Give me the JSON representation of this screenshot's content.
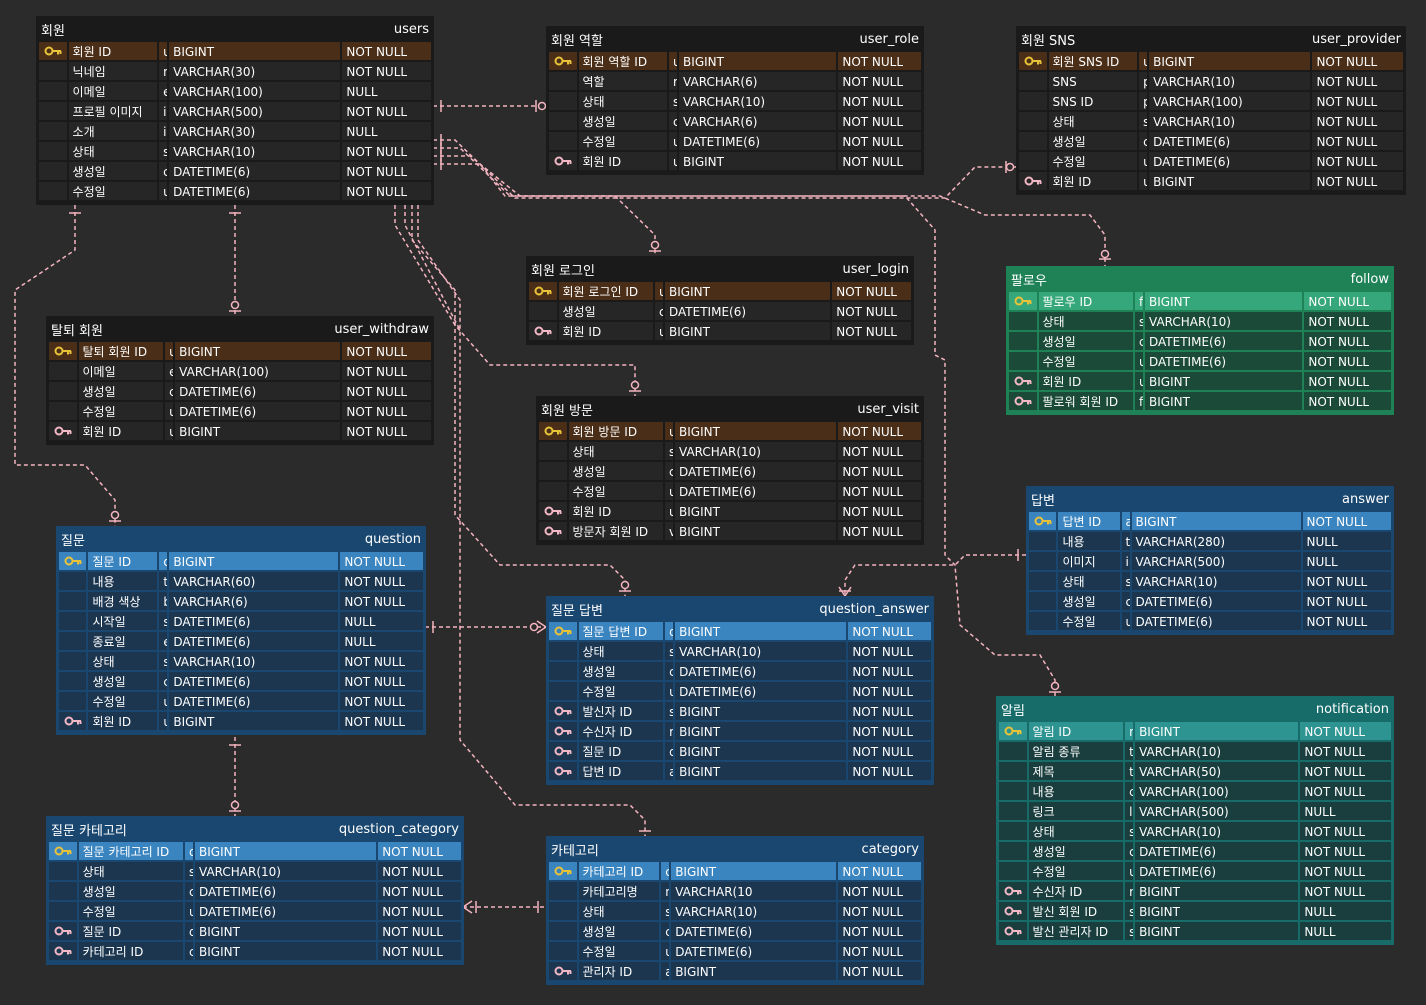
{
  "colors": {
    "line": "#f4b4c0",
    "pk_key": "#e8c33a",
    "fk_key": "#f2b8c6"
  },
  "tables": {
    "users": {
      "label": "회원",
      "name": "users",
      "columns": [
        {
          "kor": "회원 ID",
          "name": "user_id",
          "type": "BIGINT",
          "nullability": "NOT NULL",
          "key": "pk"
        },
        {
          "kor": "닉네임",
          "name": "nickname",
          "type": "VARCHAR(30)",
          "nullability": "NOT NULL",
          "key": ""
        },
        {
          "kor": "이메일",
          "name": "email",
          "type": "VARCHAR(100)",
          "nullability": "NULL",
          "key": ""
        },
        {
          "kor": "프로필 이미지",
          "name": "image_url",
          "type": "VARCHAR(500)",
          "nullability": "NOT NULL",
          "key": ""
        },
        {
          "kor": "소개",
          "name": "introduction",
          "type": "VARCHAR(30)",
          "nullability": "NULL",
          "key": ""
        },
        {
          "kor": "상태",
          "name": "status",
          "type": "VARCHAR(10)",
          "nullability": "NOT NULL",
          "key": ""
        },
        {
          "kor": "생성일",
          "name": "create_date_time",
          "type": "DATETIME(6)",
          "nullability": "NOT NULL",
          "key": ""
        },
        {
          "kor": "수정일",
          "name": "update_date_time",
          "type": "DATETIME(6)",
          "nullability": "NOT NULL",
          "key": ""
        }
      ]
    },
    "user_role": {
      "label": "회원 역할",
      "name": "user_role",
      "columns": [
        {
          "kor": "회원 역할 ID",
          "name": "user_role_id",
          "type": "BIGINT",
          "nullability": "NOT NULL",
          "key": "pk"
        },
        {
          "kor": "역할",
          "name": "role",
          "type": "VARCHAR(6)",
          "nullability": "NOT NULL",
          "key": ""
        },
        {
          "kor": "상태",
          "name": "status",
          "type": "VARCHAR(10)",
          "nullability": "NOT NULL",
          "key": ""
        },
        {
          "kor": "생성일",
          "name": "create_date_time",
          "type": "VARCHAR(6)",
          "nullability": "NOT NULL",
          "key": ""
        },
        {
          "kor": "수정일",
          "name": "update_date_time",
          "type": "DATETIME(6)",
          "nullability": "NOT NULL",
          "key": ""
        },
        {
          "kor": "회원 ID",
          "name": "user_id",
          "type": "BIGINT",
          "nullability": "NOT NULL",
          "key": "fk"
        }
      ]
    },
    "user_provider": {
      "label": "회원 SNS",
      "name": "user_provider",
      "columns": [
        {
          "kor": "회원 SNS ID",
          "name": "user_provider_id",
          "type": "BIGINT",
          "nullability": "NOT NULL",
          "key": "pk"
        },
        {
          "kor": "SNS",
          "name": "provider",
          "type": "VARCHAR(10)",
          "nullability": "NOT NULL",
          "key": ""
        },
        {
          "kor": "SNS ID",
          "name": "provider_id",
          "type": "VARCHAR(100)",
          "nullability": "NOT NULL",
          "key": ""
        },
        {
          "kor": "상태",
          "name": "status",
          "type": "VARCHAR(10)",
          "nullability": "NOT NULL",
          "key": ""
        },
        {
          "kor": "생성일",
          "name": "create_date_time",
          "type": "DATETIME(6)",
          "nullability": "NOT NULL",
          "key": ""
        },
        {
          "kor": "수정일",
          "name": "update_date_time",
          "type": "DATETIME(6)",
          "nullability": "NOT NULL",
          "key": ""
        },
        {
          "kor": "회원 ID",
          "name": "user_id",
          "type": "BIGINT",
          "nullability": "NOT NULL",
          "key": "fk"
        }
      ]
    },
    "user_login": {
      "label": "회원 로그인",
      "name": "user_login",
      "columns": [
        {
          "kor": "회원 로그인 ID",
          "name": "user_login_id",
          "type": "BIGINT",
          "nullability": "NOT NULL",
          "key": "pk"
        },
        {
          "kor": "생성일",
          "name": "create_date_time",
          "type": "DATETIME(6)",
          "nullability": "NOT NULL",
          "key": ""
        },
        {
          "kor": "회원 ID",
          "name": "user_id",
          "type": "BIGINT",
          "nullability": "NOT NULL",
          "key": "fk"
        }
      ]
    },
    "follow": {
      "label": "팔로우",
      "name": "follow",
      "columns": [
        {
          "kor": "팔로우 ID",
          "name": "follow_id",
          "type": "BIGINT",
          "nullability": "NOT NULL",
          "key": "pk"
        },
        {
          "kor": "상태",
          "name": "status",
          "type": "VARCHAR(10)",
          "nullability": "NOT NULL",
          "key": ""
        },
        {
          "kor": "생성일",
          "name": "create_date_time",
          "type": "DATETIME(6)",
          "nullability": "NOT NULL",
          "key": ""
        },
        {
          "kor": "수정일",
          "name": "update_date_time",
          "type": "DATETIME(6)",
          "nullability": "NOT NULL",
          "key": ""
        },
        {
          "kor": "회원 ID",
          "name": "user_id",
          "type": "BIGINT",
          "nullability": "NOT NULL",
          "key": "fk"
        },
        {
          "kor": "팔로워 회원 ID",
          "name": "follower_user_id",
          "type": "BIGINT",
          "nullability": "NOT NULL",
          "key": "fk"
        }
      ]
    },
    "user_withdraw": {
      "label": "탈퇴 회원",
      "name": "user_withdraw",
      "columns": [
        {
          "kor": "탈퇴 회원 ID",
          "name": "user_withdraw_id",
          "type": "BIGINT",
          "nullability": "NOT NULL",
          "key": "pk"
        },
        {
          "kor": "이메일",
          "name": "email",
          "type": "VARCHAR(100)",
          "nullability": "NOT NULL",
          "key": ""
        },
        {
          "kor": "생성일",
          "name": "create_date_time",
          "type": "DATETIME(6)",
          "nullability": "NOT NULL",
          "key": ""
        },
        {
          "kor": "수정일",
          "name": "update_date_time",
          "type": "DATETIME(6)",
          "nullability": "NOT NULL",
          "key": ""
        },
        {
          "kor": "회원 ID",
          "name": "user_id",
          "type": "BIGINT",
          "nullability": "NOT NULL",
          "key": "fk"
        }
      ]
    },
    "user_visit": {
      "label": "회원 방문",
      "name": "user_visit",
      "columns": [
        {
          "kor": "회원 방문 ID",
          "name": "user_visit_id",
          "type": "BIGINT",
          "nullability": "NOT NULL",
          "key": "pk"
        },
        {
          "kor": "상태",
          "name": "status",
          "type": "VARCHAR(10)",
          "nullability": "NOT NULL",
          "key": ""
        },
        {
          "kor": "생성일",
          "name": "create_date_time",
          "type": "DATETIME(6)",
          "nullability": "NOT NULL",
          "key": ""
        },
        {
          "kor": "수정일",
          "name": "update_date_time",
          "type": "DATETIME(6)",
          "nullability": "NOT NULL",
          "key": ""
        },
        {
          "kor": "회원 ID",
          "name": "user_id",
          "type": "BIGINT",
          "nullability": "NOT NULL",
          "key": "fk"
        },
        {
          "kor": "방문자 회원 ID",
          "name": "visitor_user_id",
          "type": "BIGINT",
          "nullability": "NOT NULL",
          "key": "fk"
        }
      ]
    },
    "answer": {
      "label": "답변",
      "name": "answer",
      "columns": [
        {
          "kor": "답변 ID",
          "name": "answer_id",
          "type": "BIGINT",
          "nullability": "NOT NULL",
          "key": "pk"
        },
        {
          "kor": "내용",
          "name": "text",
          "type": "VARCHAR(280)",
          "nullability": "NULL",
          "key": ""
        },
        {
          "kor": "이미지",
          "name": "image_url",
          "type": "VARCHAR(500)",
          "nullability": "NULL",
          "key": ""
        },
        {
          "kor": "상태",
          "name": "status",
          "type": "VARCHAR(10)",
          "nullability": "NOT NULL",
          "key": ""
        },
        {
          "kor": "생성일",
          "name": "create_date_time",
          "type": "DATETIME(6)",
          "nullability": "NOT NULL",
          "key": ""
        },
        {
          "kor": "수정일",
          "name": "update_date_time",
          "type": "DATETIME(6)",
          "nullability": "NOT NULL",
          "key": ""
        }
      ]
    },
    "question": {
      "label": "질문",
      "name": "question",
      "columns": [
        {
          "kor": "질문 ID",
          "name": "question_id",
          "type": "BIGINT",
          "nullability": "NOT NULL",
          "key": "pk"
        },
        {
          "kor": "내용",
          "name": "text",
          "type": "VARCHAR(60)",
          "nullability": "NOT NULL",
          "key": ""
        },
        {
          "kor": "배경 색상",
          "name": "background_color",
          "type": "VARCHAR(6)",
          "nullability": "NOT NULL",
          "key": ""
        },
        {
          "kor": "시작일",
          "name": "start_date_time",
          "type": "DATETIME(6)",
          "nullability": "NULL",
          "key": ""
        },
        {
          "kor": "종료일",
          "name": "end_date_time",
          "type": "DATETIME(6)",
          "nullability": "NULL",
          "key": ""
        },
        {
          "kor": "상태",
          "name": "status",
          "type": "VARCHAR(10)",
          "nullability": "NOT NULL",
          "key": ""
        },
        {
          "kor": "생성일",
          "name": "create_date_time",
          "type": "DATETIME(6)",
          "nullability": "NOT NULL",
          "key": ""
        },
        {
          "kor": "수정일",
          "name": "update_date_time",
          "type": "DATETIME(6)",
          "nullability": "NOT NULL",
          "key": ""
        },
        {
          "kor": "회원 ID",
          "name": "user_id",
          "type": "BIGINT",
          "nullability": "NOT NULL",
          "key": "fk"
        }
      ]
    },
    "question_answer": {
      "label": "질문 답변",
      "name": "question_answer",
      "columns": [
        {
          "kor": "질문 답변 ID",
          "name": "question_answer_id",
          "type": "BIGINT",
          "nullability": "NOT NULL",
          "key": "pk"
        },
        {
          "kor": "상태",
          "name": "status",
          "type": "VARCHAR(10)",
          "nullability": "NOT NULL",
          "key": ""
        },
        {
          "kor": "생성일",
          "name": "create_date_time",
          "type": "DATETIME(6)",
          "nullability": "NOT NULL",
          "key": ""
        },
        {
          "kor": "수정일",
          "name": "update_date_time",
          "type": "DATETIME(6)",
          "nullability": "NOT NULL",
          "key": ""
        },
        {
          "kor": "발신자 ID",
          "name": "sender_id",
          "type": "BIGINT",
          "nullability": "NOT NULL",
          "key": "fk"
        },
        {
          "kor": "수신자 ID",
          "name": "receiver_id",
          "type": "BIGINT",
          "nullability": "NOT NULL",
          "key": "fk"
        },
        {
          "kor": "질문 ID",
          "name": "question_id",
          "type": "BIGINT",
          "nullability": "NOT NULL",
          "key": "fk"
        },
        {
          "kor": "답변 ID",
          "name": "answer_id",
          "type": "BIGINT",
          "nullability": "NOT NULL",
          "key": "fk"
        }
      ]
    },
    "notification": {
      "label": "알림",
      "name": "notification",
      "columns": [
        {
          "kor": "알림 ID",
          "name": "notification_id",
          "type": "BIGINT",
          "nullability": "NOT NULL",
          "key": "pk"
        },
        {
          "kor": "알림 종류",
          "name": "type",
          "type": "VARCHAR(10)",
          "nullability": "NOT NULL",
          "key": ""
        },
        {
          "kor": "제목",
          "name": "title",
          "type": "VARCHAR(50)",
          "nullability": "NOT NULL",
          "key": ""
        },
        {
          "kor": "내용",
          "name": "context",
          "type": "VARCHAR(100)",
          "nullability": "NOT NULL",
          "key": ""
        },
        {
          "kor": "링크",
          "name": "link",
          "type": "VARCHAR(500)",
          "nullability": "NULL",
          "key": ""
        },
        {
          "kor": "상태",
          "name": "status",
          "type": "VARCHAR(10)",
          "nullability": "NOT NULL",
          "key": ""
        },
        {
          "kor": "생성일",
          "name": "create_date_time",
          "type": "DATETIME(6)",
          "nullability": "NOT NULL",
          "key": ""
        },
        {
          "kor": "수정일",
          "name": "update_date_time",
          "type": "DATETIME(6)",
          "nullability": "NOT NULL",
          "key": ""
        },
        {
          "kor": "수신자 ID",
          "name": "receiver_id",
          "type": "BIGINT",
          "nullability": "NOT NULL",
          "key": "fk"
        },
        {
          "kor": "발신 회원 ID",
          "name": "sender_user_id",
          "type": "BIGINT",
          "nullability": "NULL",
          "key": "fk"
        },
        {
          "kor": "발신 관리자 ID",
          "name": "sender_admin_id",
          "type": "BIGINT",
          "nullability": "NULL",
          "key": "fk"
        }
      ]
    },
    "question_category": {
      "label": "질문 카테고리",
      "name": "question_category",
      "columns": [
        {
          "kor": "질문 카테고리 ID",
          "name": "question_category_id",
          "type": "BIGINT",
          "nullability": "NOT NULL",
          "key": "pk"
        },
        {
          "kor": "상태",
          "name": "status",
          "type": "VARCHAR(10)",
          "nullability": "NOT NULL",
          "key": ""
        },
        {
          "kor": "생성일",
          "name": "create_date_time",
          "type": "DATETIME(6)",
          "nullability": "NOT NULL",
          "key": ""
        },
        {
          "kor": "수정일",
          "name": "update_date_time",
          "type": "DATETIME(6)",
          "nullability": "NOT NULL",
          "key": ""
        },
        {
          "kor": "질문 ID",
          "name": "question_id",
          "type": "BIGINT",
          "nullability": "NOT NULL",
          "key": "fk"
        },
        {
          "kor": "카테고리 ID",
          "name": "category_id",
          "type": "BIGINT",
          "nullability": "NOT NULL",
          "key": "fk"
        }
      ]
    },
    "category": {
      "label": "카테고리",
      "name": "category",
      "columns": [
        {
          "kor": "카테고리 ID",
          "name": "category_id",
          "type": "BIGINT",
          "nullability": "NOT NULL",
          "key": "pk"
        },
        {
          "kor": "카테고리명",
          "name": "name",
          "type": "VARCHAR(10",
          "nullability": "NOT NULL",
          "key": ""
        },
        {
          "kor": "상태",
          "name": "status",
          "type": "VARCHAR(10)",
          "nullability": "NOT NULL",
          "key": ""
        },
        {
          "kor": "생성일",
          "name": "create_date_time",
          "type": "DATETIME(6)",
          "nullability": "NOT NULL",
          "key": ""
        },
        {
          "kor": "수정일",
          "name": "update_date_time",
          "type": "DATETIME(6)",
          "nullability": "NOT NULL",
          "key": ""
        },
        {
          "kor": "관리자 ID",
          "name": "admin_id",
          "type": "BIGINT",
          "nullability": "NOT NULL",
          "key": "fk"
        }
      ]
    }
  }
}
